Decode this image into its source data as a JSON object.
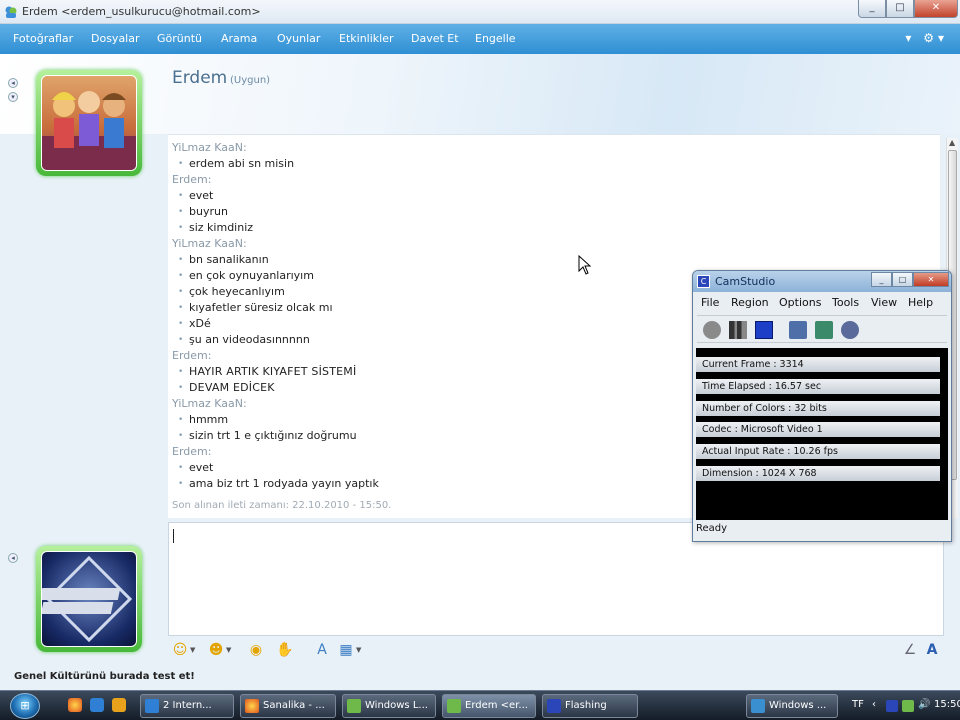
{
  "window": {
    "title": "Erdem <erdem_usulkurucu@hotmail.com>",
    "controls": {
      "minimize": "_",
      "maximize": "□",
      "close": "✕"
    }
  },
  "menu": [
    "Fotoğraflar",
    "Dosyalar",
    "Görüntü",
    "Arama",
    "Oyunlar",
    "Etkinlikler",
    "Davet Et",
    "Engelle"
  ],
  "menu_tools": "▾ ⚙▾",
  "contact": {
    "name": "Erdem",
    "status": "(Uygun)"
  },
  "messages": [
    {
      "sender": "YiLmaz KaaN:",
      "lines": [
        "erdem abi sn misin"
      ]
    },
    {
      "sender": "Erdem:",
      "lines": [
        "evet",
        "buyrun",
        "siz kimdiniz"
      ]
    },
    {
      "sender": "YiLmaz KaaN:",
      "lines": [
        "bn sanalikanın",
        "en çok oynuyanlarıyım",
        "çok heyecanlıyım",
        "kıyafetler süresiz olcak mı",
        "xDé",
        "şu an videodasınnnnn"
      ]
    },
    {
      "sender": "Erdem:",
      "lines": [
        "HAYIR ARTIK KIYAFET SİSTEMİ",
        "DEVAM EDİCEK"
      ]
    },
    {
      "sender": "YiLmaz KaaN:",
      "lines": [
        "hmmm",
        "sizin trt 1 e çıktığınız doğrumu"
      ]
    },
    {
      "sender": "Erdem:",
      "lines": [
        "evet",
        "ama biz trt 1 rodyada yayın yaptık"
      ]
    }
  ],
  "last_message": "Son alınan ileti zamanı: 22.10.2010 - 15:50.",
  "promo_text": "Genel Kültürünü burada test et!",
  "camstudio": {
    "title": "CamStudio",
    "menu": [
      "File",
      "Region",
      "Options",
      "Tools",
      "View",
      "Help"
    ],
    "stats": [
      "Current Frame : 3314",
      "Time Elapsed : 16.57 sec",
      "Number of Colors : 32 bits",
      "Codec : Microsoft Video 1",
      "Actual Input Rate : 10.26 fps",
      "Dimension : 1024 X 768"
    ],
    "status": "Ready"
  },
  "taskbar": {
    "buttons": [
      "2 Intern...",
      "Sanalika - ...",
      "Windows L...",
      "Erdem <er...",
      "Flashing",
      "Windows ..."
    ],
    "tray_lang": "TF",
    "clock": "15:50"
  },
  "colors": {
    "menubar": "#2f8fd3",
    "avatar_frame": "#48b83a",
    "taskbar": "#1b2533"
  }
}
